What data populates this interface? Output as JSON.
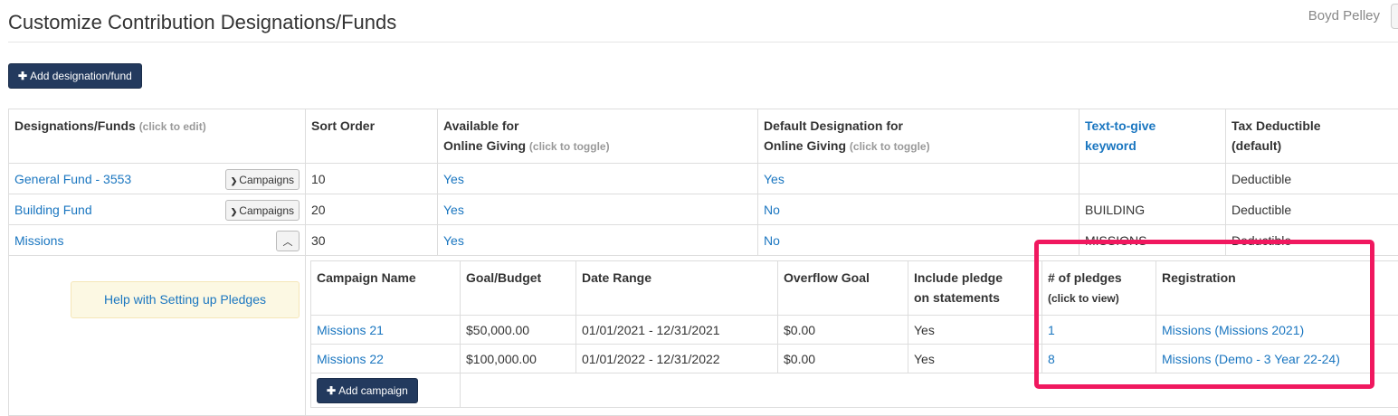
{
  "header": {
    "title": "Customize Contribution Designations/Funds",
    "user_name": "Boyd Pelley"
  },
  "toolbar": {
    "add_fund_label": "Add designation/fund"
  },
  "table": {
    "headers": {
      "fund": "Designations/Funds",
      "fund_hint": "(click to edit)",
      "sort": "Sort Order",
      "online_line1": "Available for",
      "online_line2": "Online Giving",
      "online_hint": "(click to toggle)",
      "default_line1": "Default Designation for",
      "default_line2": "Online Giving",
      "default_hint": "(click to toggle)",
      "keyword_line1": "Text-to-give",
      "keyword_line2": "keyword",
      "tax_line1": "Tax Deductible",
      "tax_line2": "(default)"
    },
    "rows": [
      {
        "name": "General Fund - 3553",
        "sort": "10",
        "online": "Yes",
        "default": "Yes",
        "keyword": "",
        "tax": "Deductible",
        "campaigns_label": "Campaigns"
      },
      {
        "name": "Building Fund",
        "sort": "20",
        "online": "Yes",
        "default": "No",
        "keyword": "BUILDING",
        "tax": "Deductible",
        "campaigns_label": "Campaigns"
      },
      {
        "name": "Missions",
        "sort": "30",
        "online": "Yes",
        "default": "No",
        "keyword": "MISSIONS",
        "tax": "Deductible",
        "collapse_icon": "chevron-up-icon"
      }
    ]
  },
  "help": {
    "label": "Help with Setting up Pledges"
  },
  "campaigns": {
    "headers": {
      "name": "Campaign Name",
      "goal": "Goal/Budget",
      "range": "Date Range",
      "overflow": "Overflow Goal",
      "include_line1": "Include pledge",
      "include_line2": "on statements",
      "pledges": "# of pledges",
      "pledges_hint": "(click to view)",
      "registration": "Registration"
    },
    "rows": [
      {
        "name": "Missions 21",
        "goal": "$50,000.00",
        "range": "01/01/2021 - 12/31/2021",
        "overflow": "$0.00",
        "include": "Yes",
        "pledges": "1",
        "registration": "Missions (Missions 2021)"
      },
      {
        "name": "Missions 22",
        "goal": "$100,000.00",
        "range": "01/01/2022 - 12/31/2022",
        "overflow": "$0.00",
        "include": "Yes",
        "pledges": "8",
        "registration": "Missions (Demo - 3 Year 22-24)"
      }
    ],
    "add_label": "Add campaign"
  },
  "colors": {
    "primary_button": "#233a5e",
    "link": "#1a76c0",
    "highlight": "#f0185f",
    "help_background": "#fcf8e3"
  }
}
